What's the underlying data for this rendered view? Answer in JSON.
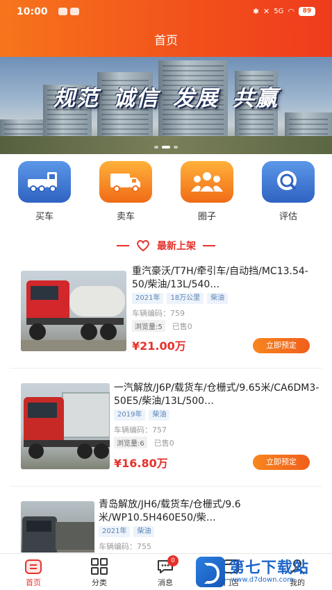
{
  "status_bar": {
    "time": "10:00",
    "signal": "5G",
    "battery": "89"
  },
  "header": {
    "title": "首页"
  },
  "banner": {
    "slogan": [
      "规范",
      "诚信",
      "发展",
      "共赢"
    ]
  },
  "quick_nav": [
    {
      "label": "买车",
      "icon": "truck-icon"
    },
    {
      "label": "卖车",
      "icon": "delivery-truck-icon"
    },
    {
      "label": "圈子",
      "icon": "group-icon"
    },
    {
      "label": "评估",
      "icon": "search-icon"
    }
  ],
  "section": {
    "title": "最新上架"
  },
  "listings": [
    {
      "title": "重汽豪沃/T7H/牵引车/自动挡/MC13.54-50/柴油/13L/540…",
      "tags": [
        "2021年",
        "18万公里",
        "柴油"
      ],
      "code_label": "车辆编码：",
      "code": "759",
      "views": "浏览量:5",
      "sold": "已售0",
      "price": "¥21.00万",
      "button": "立即预定"
    },
    {
      "title": "一汽解放/J6P/载货车/仓栅式/9.65米/CA6DM3-50E5/柴油/13L/500…",
      "tags": [
        "2019年",
        "柴油"
      ],
      "code_label": "车辆编码：",
      "code": "757",
      "views": "浏览量:6",
      "sold": "已售0",
      "price": "¥16.80万",
      "button": "立即预定"
    },
    {
      "title": "青岛解放/JH6/载货车/仓栅式/9.6米/WP10.5H460E50/柴…",
      "tags": [
        "2021年",
        "柴油"
      ],
      "code_label": "车辆编码：",
      "code": "755"
    }
  ],
  "tabbar": [
    {
      "label": "首页",
      "icon": "home-icon",
      "active": true
    },
    {
      "label": "分类",
      "icon": "grid-icon"
    },
    {
      "label": "消息",
      "icon": "chat-icon",
      "badge": "0"
    },
    {
      "label": "门店",
      "icon": "store-icon"
    },
    {
      "label": "我的",
      "icon": "user-icon"
    }
  ],
  "watermark": {
    "main": "第七下载站",
    "sub": "www.d7down.com"
  },
  "colors": {
    "accent": "#e5312b",
    "header_start": "#f7751c",
    "header_end": "#ef3b1d",
    "button": "#f05f1c"
  }
}
